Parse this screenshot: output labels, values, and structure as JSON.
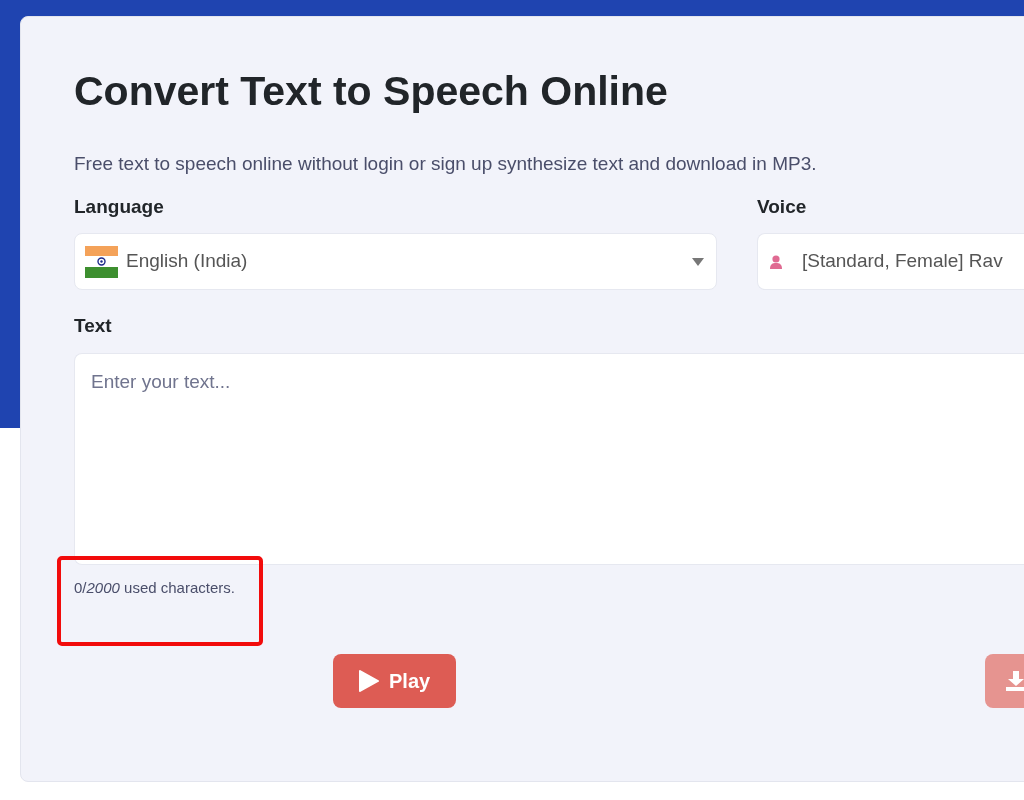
{
  "title": "Convert Text to Speech Online",
  "description": "Free text to speech online without login or sign up synthesize text and download in MP3.",
  "language": {
    "label": "Language",
    "value": "English (India)"
  },
  "voice": {
    "label": "Voice",
    "value": "[Standard, Female] Rav"
  },
  "text": {
    "label": "Text",
    "placeholder": "Enter your text..."
  },
  "counter": "0/*2000* used characters.",
  "buttons": [
    {
      "kind": "play",
      "label": "Play",
      "disabled": false
    },
    {
      "kind": "download",
      "disabled": true
    }
  ]
}
